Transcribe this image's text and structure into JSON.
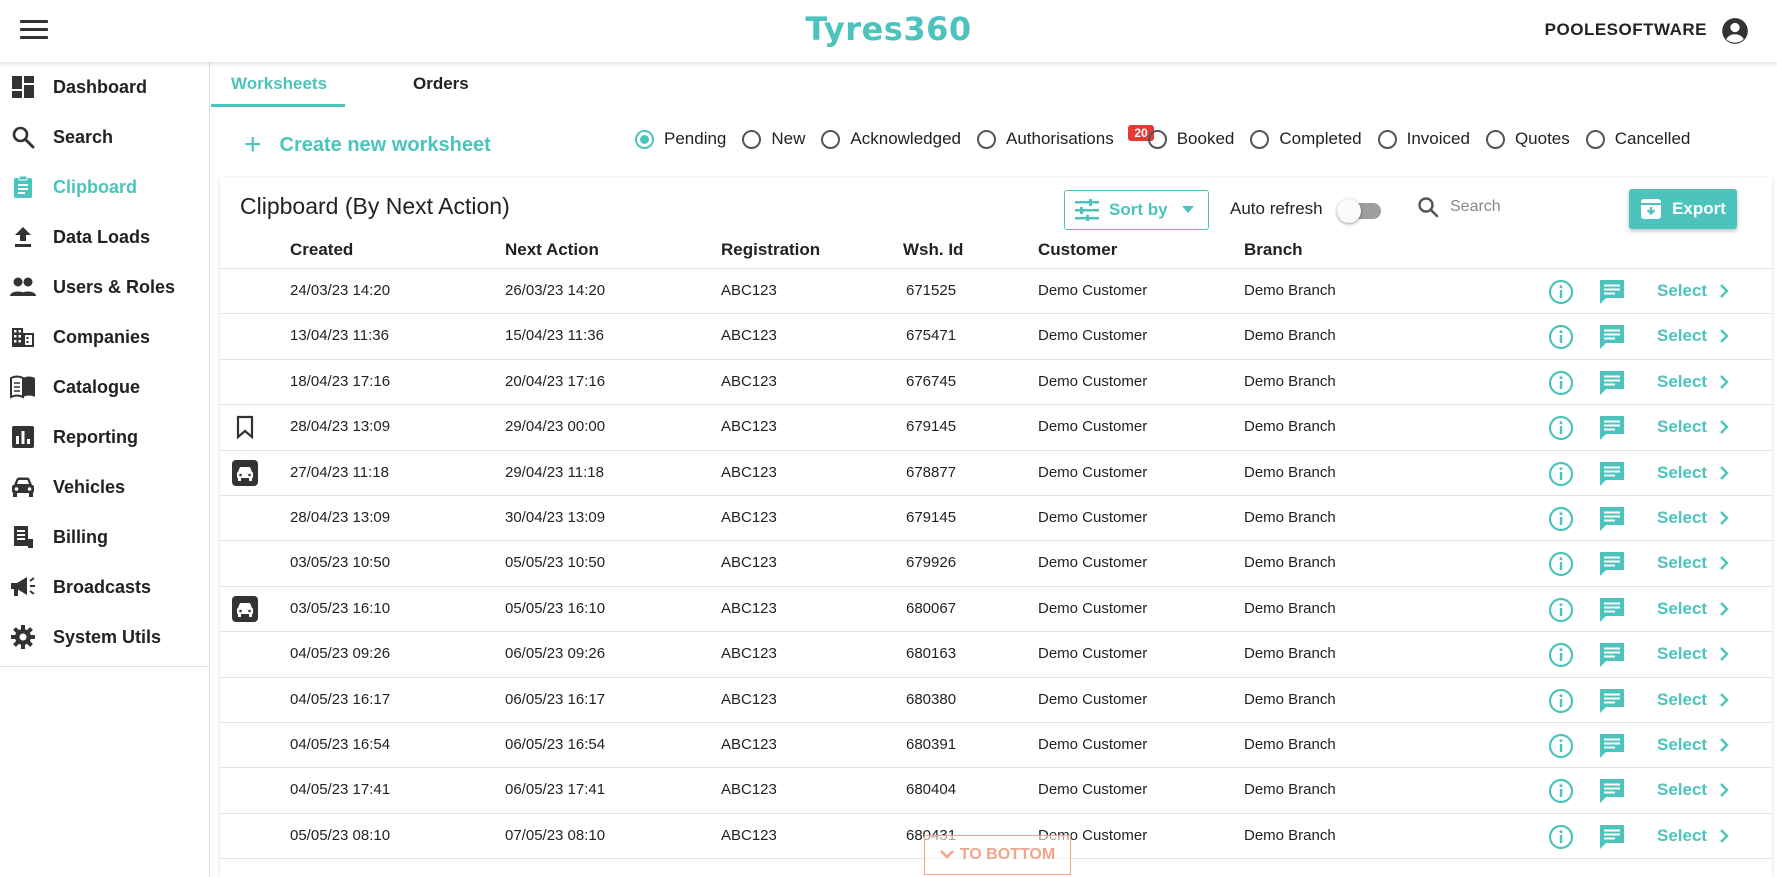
{
  "header": {
    "brand": "Tyres360",
    "user": "POOLESOFTWARE"
  },
  "sidebar": {
    "items": [
      {
        "label": "Dashboard",
        "icon": "dashboard-icon"
      },
      {
        "label": "Search",
        "icon": "search-icon"
      },
      {
        "label": "Clipboard",
        "icon": "clipboard-icon",
        "active": true
      },
      {
        "label": "Data Loads",
        "icon": "upload-icon"
      },
      {
        "label": "Users & Roles",
        "icon": "users-icon"
      },
      {
        "label": "Companies",
        "icon": "building-icon"
      },
      {
        "label": "Catalogue",
        "icon": "book-icon"
      },
      {
        "label": "Reporting",
        "icon": "chart-icon"
      },
      {
        "label": "Vehicles",
        "icon": "car-icon"
      },
      {
        "label": "Billing",
        "icon": "receipt-icon"
      },
      {
        "label": "Broadcasts",
        "icon": "megaphone-icon"
      },
      {
        "label": "System Utils",
        "icon": "gear-icon"
      }
    ]
  },
  "tabs": {
    "worksheets": "Worksheets",
    "orders": "Orders"
  },
  "create": {
    "label": "Create new worksheet"
  },
  "filters": {
    "pending": "Pending",
    "new": "New",
    "acknowledged": "Acknowledged",
    "authorisations": "Authorisations",
    "authorisations_count": "20",
    "booked": "Booked",
    "completed": "Completed",
    "invoiced": "Invoiced",
    "quotes": "Quotes",
    "cancelled": "Cancelled",
    "selected": "Pending"
  },
  "clipboard": {
    "title": "Clipboard (By Next Action)",
    "sort_label": "Sort by",
    "auto_refresh_label": "Auto refresh",
    "auto_refresh_on": false,
    "search_placeholder": "Search",
    "export_label": "Export"
  },
  "table": {
    "headers": {
      "created": "Created",
      "next_action": "Next Action",
      "registration": "Registration",
      "wsh_id": "Wsh. Id",
      "customer": "Customer",
      "branch": "Branch"
    },
    "select_label": "Select",
    "rows": [
      {
        "flag": "",
        "created": "24/03/23 14:20",
        "next": "26/03/23 14:20",
        "reg": "ABC123",
        "wsh": "671525",
        "cust": "Demo Customer",
        "branch": "Demo Branch"
      },
      {
        "flag": "",
        "created": "13/04/23 11:36",
        "next": "15/04/23 11:36",
        "reg": "ABC123",
        "wsh": "675471",
        "cust": "Demo Customer",
        "branch": "Demo Branch"
      },
      {
        "flag": "",
        "created": "18/04/23 17:16",
        "next": "20/04/23 17:16",
        "reg": "ABC123",
        "wsh": "676745",
        "cust": "Demo Customer",
        "branch": "Demo Branch"
      },
      {
        "flag": "bookmark",
        "created": "28/04/23 13:09",
        "next": "29/04/23 00:00",
        "reg": "ABC123",
        "wsh": "679145",
        "cust": "Demo Customer",
        "branch": "Demo Branch"
      },
      {
        "flag": "car",
        "created": "27/04/23 11:18",
        "next": "29/04/23 11:18",
        "reg": "ABC123",
        "wsh": "678877",
        "cust": "Demo Customer",
        "branch": "Demo Branch"
      },
      {
        "flag": "",
        "created": "28/04/23 13:09",
        "next": "30/04/23 13:09",
        "reg": "ABC123",
        "wsh": "679145",
        "cust": "Demo Customer",
        "branch": "Demo Branch"
      },
      {
        "flag": "",
        "created": "03/05/23 10:50",
        "next": "05/05/23 10:50",
        "reg": "ABC123",
        "wsh": "679926",
        "cust": "Demo Customer",
        "branch": "Demo Branch"
      },
      {
        "flag": "car",
        "created": "03/05/23 16:10",
        "next": "05/05/23 16:10",
        "reg": "ABC123",
        "wsh": "680067",
        "cust": "Demo Customer",
        "branch": "Demo Branch"
      },
      {
        "flag": "",
        "created": "04/05/23 09:26",
        "next": "06/05/23 09:26",
        "reg": "ABC123",
        "wsh": "680163",
        "cust": "Demo Customer",
        "branch": "Demo Branch"
      },
      {
        "flag": "",
        "created": "04/05/23 16:17",
        "next": "06/05/23 16:17",
        "reg": "ABC123",
        "wsh": "680380",
        "cust": "Demo Customer",
        "branch": "Demo Branch"
      },
      {
        "flag": "",
        "created": "04/05/23 16:54",
        "next": "06/05/23 16:54",
        "reg": "ABC123",
        "wsh": "680391",
        "cust": "Demo Customer",
        "branch": "Demo Branch"
      },
      {
        "flag": "",
        "created": "04/05/23 17:41",
        "next": "06/05/23 17:41",
        "reg": "ABC123",
        "wsh": "680404",
        "cust": "Demo Customer",
        "branch": "Demo Branch"
      },
      {
        "flag": "",
        "created": "05/05/23 08:10",
        "next": "07/05/23 08:10",
        "reg": "ABC123",
        "wsh": "680431",
        "cust": "Demo Customer",
        "branch": "Demo Branch"
      }
    ]
  },
  "to_bottom": {
    "label": "TO BOTTOM"
  },
  "colors": {
    "accent": "#4cc3bd",
    "badge": "#e53935",
    "to_bottom": "#f1a58c"
  }
}
